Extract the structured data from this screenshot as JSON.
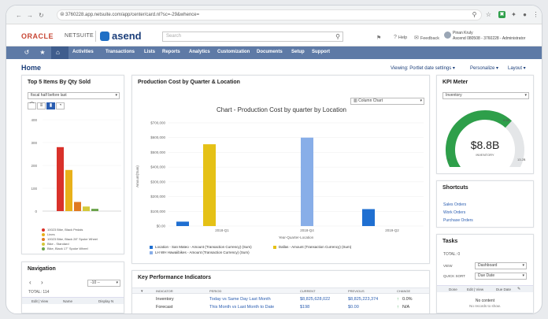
{
  "browser": {
    "url": "3760228.app.netsuite.com/app/center/card.nl?sc=-29&whence=",
    "icons": [
      "back-arrow-icon",
      "forward-arrow-icon",
      "reload-icon",
      "lock-icon",
      "zoom-icon",
      "star-icon",
      "extension-icon",
      "puzzle-icon",
      "profile-icon",
      "menu-dots-icon"
    ]
  },
  "header": {
    "brand_oracle": "ORACLE",
    "brand_netsuite": "NETSUITE",
    "brand_partner": "asend",
    "search_placeholder": "Search",
    "links": [
      {
        "icon": "⚑",
        "label": ""
      },
      {
        "icon": "?",
        "label": "Help"
      },
      {
        "icon": "✉",
        "label": "Feedback"
      }
    ],
    "user_name": "Pinan Kruly",
    "user_role": "Ascend 080508 - 3760228 - Administrator"
  },
  "menu": {
    "items": [
      "Activities",
      "Transactions",
      "Lists",
      "Reports",
      "Analytics",
      "Customization",
      "Documents",
      "Setup",
      "Support"
    ]
  },
  "page": {
    "title": "Home",
    "toolbar": [
      "Viewing: Portlet date settings ▾",
      "Personalize ▾",
      "Layout ▾"
    ]
  },
  "top5": {
    "title": "Top 5 Items By Qty Sold",
    "filter": "fiscal half before last",
    "legend": [
      "10023 Bike, Black Pedals",
      "Lines",
      "10023 Bike, Black 28\" Spoke Wheel",
      "Bike - Standard",
      "Bike, Black 17\" Spoke Wheel"
    ],
    "legend_colors": [
      "#d9312a",
      "#e8b11a",
      "#e07a22",
      "#d4c93a",
      "#6aa34b"
    ],
    "y_ticks": [
      "400",
      "300",
      "200",
      "100",
      "0"
    ],
    "chart_data": {
      "type": "bar",
      "values": [
        280,
        180,
        40,
        20,
        10
      ],
      "ylim": [
        0,
        400
      ]
    }
  },
  "navigation": {
    "title": "Navigation",
    "prev": "‹",
    "next": "›",
    "range": "-10 -- ",
    "total_label": "TOTAL: 114",
    "columns": [
      "Edit | View",
      "Name",
      "Display N"
    ]
  },
  "production": {
    "title": "Production Cost by Quarter & Location",
    "chart_type_select": "Column Chart",
    "chart_title": "Chart - Production Cost by quarter by Location",
    "y_ticks": [
      "$700,000",
      "$600,000",
      "$500,000",
      "$400,000",
      "$300,000",
      "$200,000",
      "$100,000",
      "$0.00"
    ],
    "y_label": "Amount(Sum)",
    "x_label": "Year-Quarter-Location",
    "chart_data": {
      "type": "bar",
      "categories": [
        "2018-Q1",
        "2018-Q4",
        "2019-Q2"
      ],
      "ylim": [
        0,
        700000
      ],
      "series": [
        {
          "name": "Location - San Mateo - Amount (Transaction Currency) (Sum)",
          "color": "#1f6fd1",
          "values": [
            30000,
            0,
            115000
          ]
        },
        {
          "name": "Dallas - Amount (Transaction Currency) (Sum)",
          "color": "#e5c116",
          "values": [
            555000,
            0,
            0
          ]
        },
        {
          "name": "LH WH Hawaiibikes - Amount (Transaction Currency) (Sum)",
          "color": "#88aee8",
          "values": [
            0,
            600000,
            0
          ]
        }
      ]
    }
  },
  "kpi_panel": {
    "title": "Key Performance Indicators",
    "columns": [
      "INDICATOR",
      "PERIOD",
      "CURRENT",
      "PREVIOUS",
      "CHANGE"
    ],
    "rows": [
      {
        "indicator": "Inventory",
        "period": "Today vs Same Day Last Month",
        "current": "$8,825,628,022",
        "previous": "$8,825,223,374",
        "change": "0.0%"
      },
      {
        "indicator": "Forecast",
        "period": "This Month vs Last Month to Date",
        "current": "$198",
        "previous": "$0.00",
        "change": "N/A"
      }
    ]
  },
  "kpi_meter": {
    "title": "KPI Meter",
    "select": "Inventory",
    "value": "$8.8B",
    "label": "INVENTORY",
    "scale_min": "0",
    "scale_mark": "8.8B",
    "scale_max": "13.2B",
    "fraction": 0.67
  },
  "shortcuts": {
    "title": "Shortcuts",
    "items": [
      "Sales Orders",
      "Work Orders",
      "Purchase Orders"
    ]
  },
  "tasks": {
    "title": "Tasks",
    "total_label": "TOTAL: 0",
    "view_label": "VIEW",
    "view_value": "Dashboard",
    "quicksort_label": "QUICK SORT",
    "quicksort_value": "Due Date",
    "columns": [
      "Done",
      "Edit | View",
      "Due Date"
    ],
    "empty_title": "No content",
    "empty_sub": "No records to show."
  }
}
